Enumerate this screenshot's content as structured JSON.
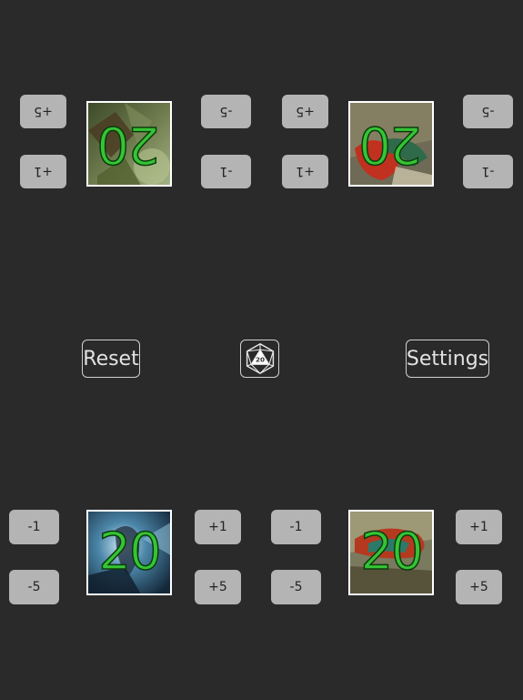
{
  "players": [
    {
      "id": "p1",
      "position": "top-left",
      "orientation": "upside-down",
      "life": "20",
      "portrait_icon": "forest-creature-portrait",
      "buttons": {
        "plus5": "+5",
        "plus1": "+1",
        "minus5": "-5",
        "minus1": "-1"
      }
    },
    {
      "id": "p2",
      "position": "top-right",
      "orientation": "upside-down",
      "life": "20",
      "portrait_icon": "red-dragon-portrait",
      "buttons": {
        "plus5": "+5",
        "plus1": "+1",
        "minus5": "-5",
        "minus1": "-1"
      }
    },
    {
      "id": "p3",
      "position": "bottom-left",
      "orientation": "upright",
      "life": "20",
      "portrait_icon": "storm-mage-portrait",
      "buttons": {
        "minus1": "-1",
        "minus5": "-5",
        "plus1": "+1",
        "plus5": "+5"
      }
    },
    {
      "id": "p4",
      "position": "bottom-right",
      "orientation": "upright",
      "life": "20",
      "portrait_icon": "dinosaur-portrait",
      "buttons": {
        "minus1": "-1",
        "minus5": "-5",
        "plus1": "+1",
        "plus5": "+5"
      }
    }
  ],
  "controls": {
    "reset_label": "Reset",
    "settings_label": "Settings",
    "dice_icon": "d20-icon",
    "dice_face": "20"
  },
  "colors": {
    "background": "#2a2a2a",
    "button": "#b4b4b4",
    "life_text": "#35c435"
  }
}
